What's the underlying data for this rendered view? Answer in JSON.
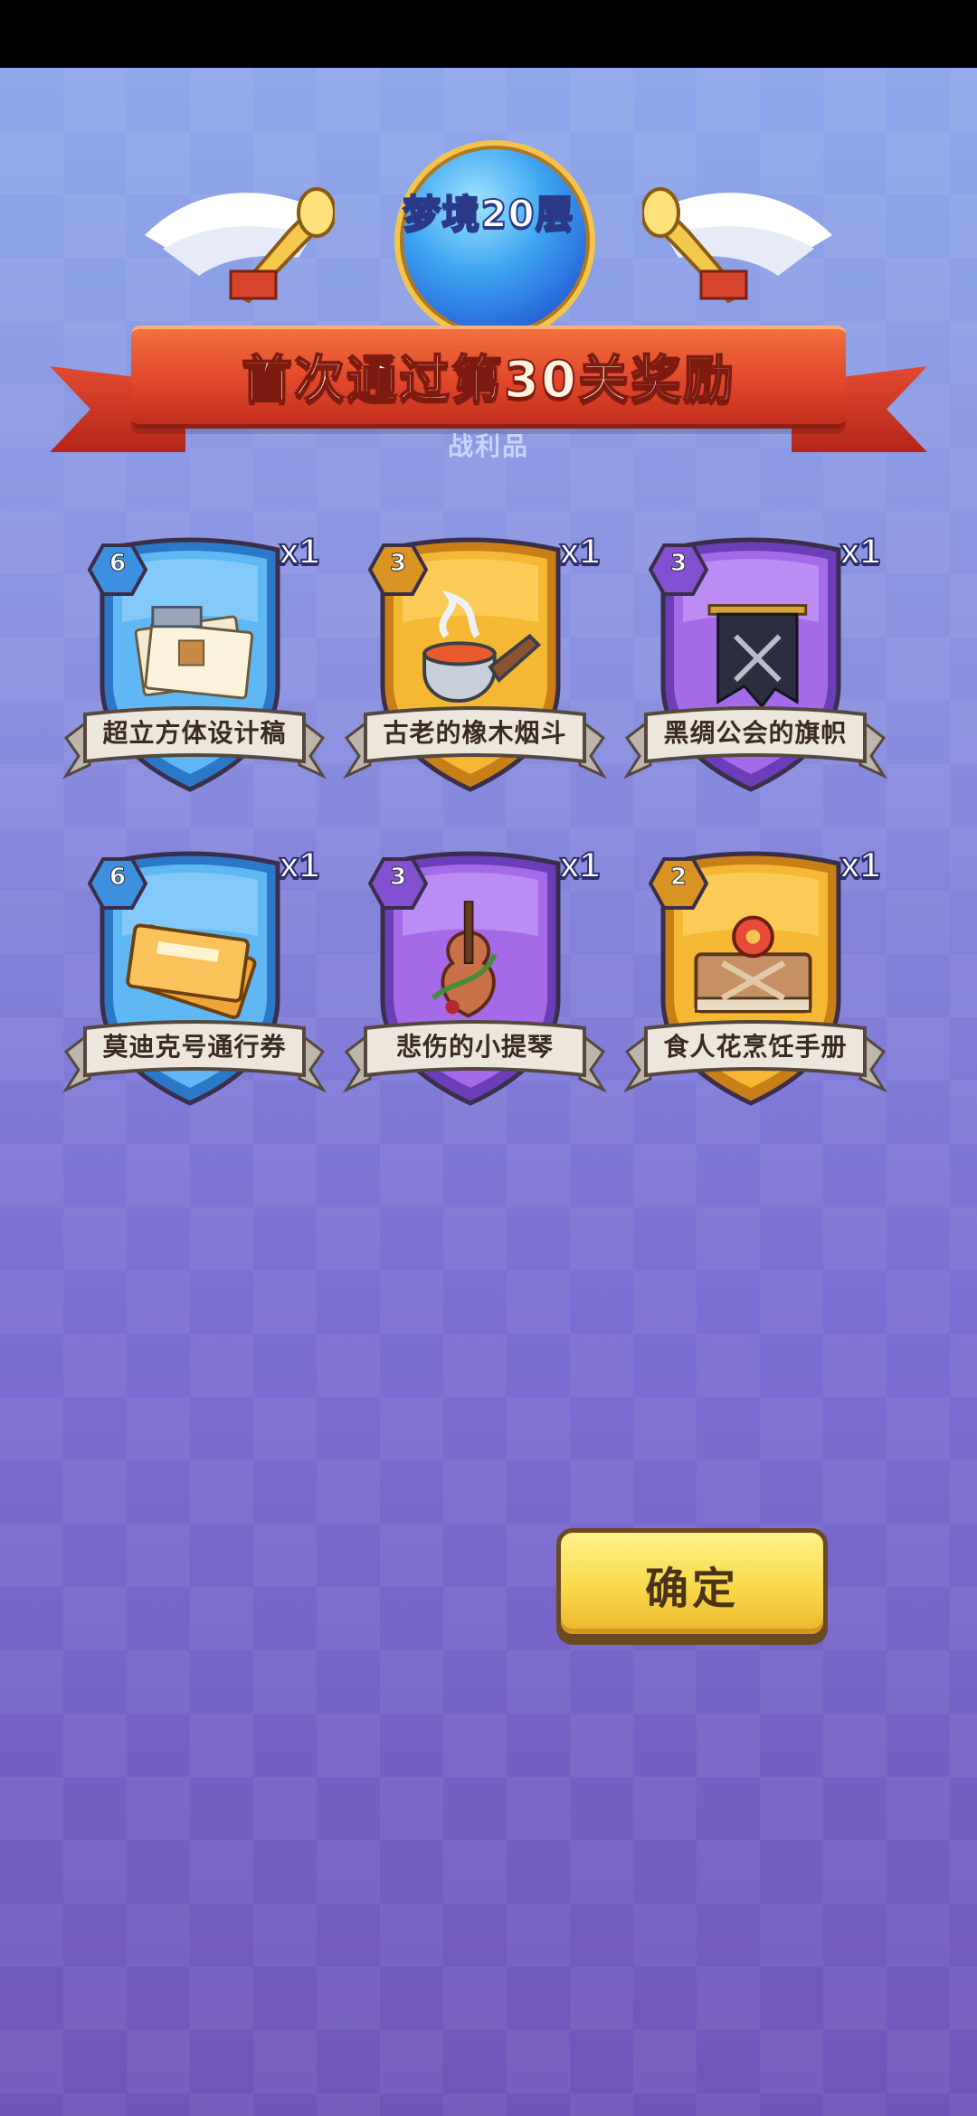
{
  "header": {
    "level_badge": "梦境20层",
    "title": "首次通过第30关奖励"
  },
  "section": {
    "label": "战利品"
  },
  "rewards": [
    {
      "name": "超立方体设计稿",
      "tier": "6",
      "quantity": "x1",
      "theme": "blue",
      "icon": "blueprint-icon"
    },
    {
      "name": "古老的橡木烟斗",
      "tier": "3",
      "quantity": "x1",
      "theme": "gold",
      "icon": "pipe-icon"
    },
    {
      "name": "黑绸公会的旗帜",
      "tier": "3",
      "quantity": "x1",
      "theme": "purple",
      "icon": "banner-flag-icon"
    },
    {
      "name": "莫迪克号通行券",
      "tier": "6",
      "quantity": "x1",
      "theme": "blue",
      "icon": "ticket-icon"
    },
    {
      "name": "悲伤的小提琴",
      "tier": "3",
      "quantity": "x1",
      "theme": "purple",
      "icon": "violin-icon"
    },
    {
      "name": "食人花烹饪手册",
      "tier": "2",
      "quantity": "x1",
      "theme": "gold",
      "icon": "cookbook-icon"
    }
  ],
  "confirm_button": {
    "label": "确定"
  },
  "colors": {
    "blue": "#5fb8f4",
    "gold": "#f4b834",
    "purple": "#a56ae8",
    "ribbon": "#e1472b"
  }
}
